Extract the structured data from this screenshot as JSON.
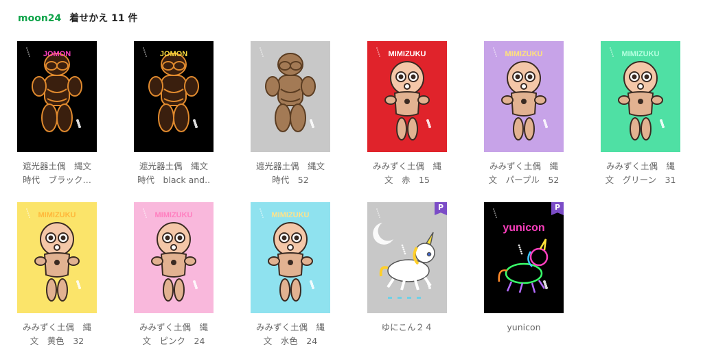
{
  "header": {
    "user": "moon24",
    "title": "着せかえ 11 件"
  },
  "badge_label": "P",
  "items": [
    {
      "line1": "遮光器土偶　縄文",
      "line2": "時代　ブラック…",
      "bg": "#000000",
      "accent": "#ff3fbf",
      "word": "JOMON",
      "figure": "jomon-glow",
      "premium": false
    },
    {
      "line1": "遮光器土偶　縄文",
      "line2": "時代　black and..",
      "bg": "#000000",
      "accent": "#ffdf3f",
      "word": "JOMON",
      "figure": "jomon-glow",
      "premium": false
    },
    {
      "line1": "遮光器土偶　縄文",
      "line2": "時代　52",
      "bg": "#c8c8c8",
      "accent": "#ffffff",
      "word": "",
      "figure": "jomon-clay",
      "premium": false
    },
    {
      "line1": "みみずく土偶　縄",
      "line2": "文　赤　15",
      "bg": "#e0232b",
      "accent": "#ffffff",
      "word": "MIMIZUKU",
      "figure": "mimizuku",
      "premium": false
    },
    {
      "line1": "みみずく土偶　縄",
      "line2": "文　パープル　52",
      "bg": "#c7a3e8",
      "accent": "#ffe27a",
      "word": "MIMIZUKU",
      "figure": "mimizuku",
      "premium": false
    },
    {
      "line1": "みみずく土偶　縄",
      "line2": "文　グリーン　31",
      "bg": "#4fe0a4",
      "accent": "#b6ffe0",
      "word": "MIMIZUKU",
      "figure": "mimizuku",
      "premium": false
    },
    {
      "line1": "みみずく土偶　縄",
      "line2": "文　黄色　32",
      "bg": "#fbe46a",
      "accent": "#ffb83a",
      "word": "MIMIZUKU",
      "figure": "mimizuku",
      "premium": false
    },
    {
      "line1": "みみずく土偶　縄",
      "line2": "文　ピンク　24",
      "bg": "#f9b8dc",
      "accent": "#ff7fbf",
      "word": "MIMIZUKU",
      "figure": "mimizuku",
      "premium": false
    },
    {
      "line1": "みみずく土偶　縄",
      "line2": "文　水色　24",
      "bg": "#8fe2ef",
      "accent": "#ffe38a",
      "word": "MIMIZUKU",
      "figure": "mimizuku",
      "premium": false
    },
    {
      "line1": "ゆにこん２４",
      "line2": "",
      "bg": "#c8c8c8",
      "accent": "#ffe33a",
      "word": "",
      "figure": "unicorn-white",
      "premium": true
    },
    {
      "line1": "yunicon",
      "line2": "",
      "bg": "#000000",
      "accent": "#ff3fbf",
      "word": "yunicon",
      "figure": "unicorn-neon",
      "premium": true
    }
  ]
}
